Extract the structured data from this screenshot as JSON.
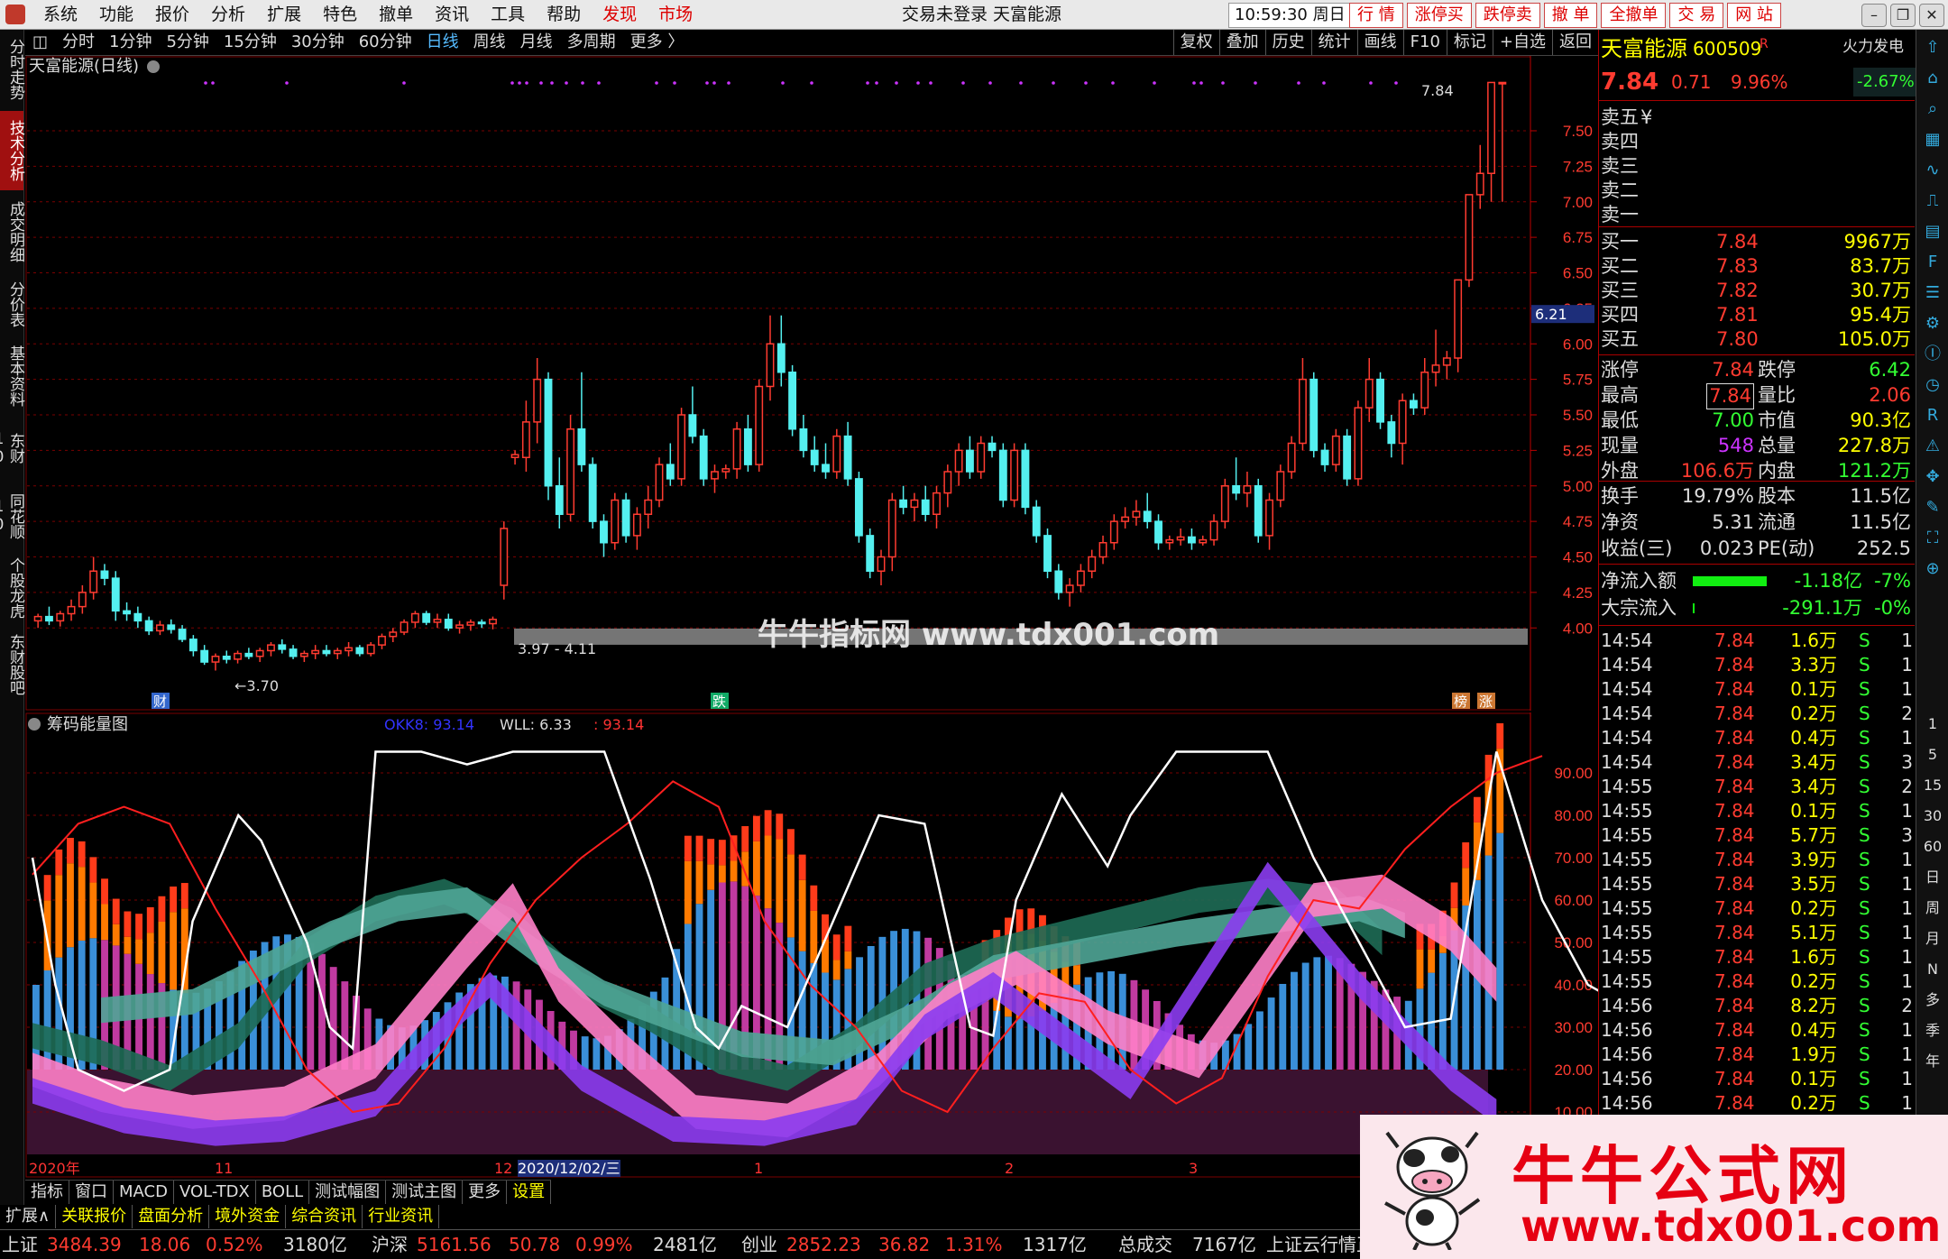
{
  "menu": {
    "items": [
      "系统",
      "功能",
      "报价",
      "分析",
      "扩展",
      "特色",
      "撤单",
      "资讯",
      "工具",
      "帮助"
    ],
    "discover": "发现",
    "market": "市场",
    "title": "交易未登录  天富能源",
    "clock": "10:59:30 周日",
    "quick": [
      "行 情",
      "涨停买",
      "跌停卖",
      "撤 单",
      "全撤单",
      "交 易",
      "网 站"
    ]
  },
  "left_tabs": [
    "分时走势",
    "技术分析",
    "成交明细",
    "分价表",
    "基本资料",
    "东财10",
    "同花顺10",
    "个股龙虎",
    "东财股吧"
  ],
  "periods": [
    "分时",
    "1分钟",
    "5分钟",
    "15分钟",
    "30分钟",
    "60分钟",
    "日线",
    "周线",
    "月线",
    "多周期",
    "更多 〉"
  ],
  "active_period": "日线",
  "right_tools": [
    "复权",
    "叠加",
    "历史",
    "统计",
    "画线",
    "F10",
    "标记",
    "+自选",
    "返回"
  ],
  "main_chart": {
    "title": "天富能源(日线)",
    "high_label": "7.84",
    "low_label": "3.70",
    "range_label": "3.97 - 4.11",
    "current_price_tag": "6.21",
    "y_ticks": [
      "7.50",
      "7.25",
      "7.00",
      "6.75",
      "6.50",
      "6.25",
      "6.00",
      "5.75",
      "5.50",
      "5.25",
      "5.00",
      "4.75",
      "4.50",
      "4.25",
      "4.00"
    ],
    "markers": [
      "财",
      "跌",
      "榜",
      "涨"
    ]
  },
  "indicator": {
    "title": "筹码能量图",
    "okk": "OKK8: 93.14",
    "wll": "WLL: 6.33",
    "last": ": 93.14",
    "y_ticks": [
      "90.00",
      "80.00",
      "70.00",
      "60.00",
      "50.00",
      "40.00",
      "30.00",
      "20.00",
      "10.00"
    ],
    "dates": [
      "2020年",
      "11",
      "12",
      "2020/12/02/三",
      "1",
      "2",
      "3"
    ]
  },
  "chart_data": {
    "type": "candlestick",
    "title": "天富能源(日线)",
    "ylim": [
      3.9,
      7.9
    ],
    "candles": [
      [
        4.05,
        4.1,
        4.0,
        4.08
      ],
      [
        4.08,
        4.15,
        4.02,
        4.05
      ],
      [
        4.05,
        4.12,
        4.01,
        4.1
      ],
      [
        4.1,
        4.2,
        4.05,
        4.15
      ],
      [
        4.15,
        4.3,
        4.1,
        4.25
      ],
      [
        4.25,
        4.5,
        4.2,
        4.4
      ],
      [
        4.4,
        4.45,
        4.3,
        4.35
      ],
      [
        4.35,
        4.4,
        4.05,
        4.12
      ],
      [
        4.12,
        4.18,
        4.05,
        4.1
      ],
      [
        4.1,
        4.15,
        4.0,
        4.05
      ],
      [
        4.05,
        4.08,
        3.95,
        3.98
      ],
      [
        3.98,
        4.05,
        3.95,
        4.02
      ],
      [
        4.02,
        4.06,
        3.96,
        3.99
      ],
      [
        3.99,
        4.02,
        3.9,
        3.92
      ],
      [
        3.92,
        3.95,
        3.8,
        3.84
      ],
      [
        3.84,
        3.88,
        3.74,
        3.76
      ],
      [
        3.76,
        3.82,
        3.7,
        3.8
      ],
      [
        3.8,
        3.84,
        3.75,
        3.78
      ],
      [
        3.78,
        3.84,
        3.75,
        3.82
      ],
      [
        3.82,
        3.86,
        3.78,
        3.8
      ],
      [
        3.8,
        3.86,
        3.76,
        3.84
      ],
      [
        3.84,
        3.9,
        3.8,
        3.88
      ],
      [
        3.88,
        3.92,
        3.82,
        3.85
      ],
      [
        3.85,
        3.88,
        3.78,
        3.8
      ],
      [
        3.8,
        3.84,
        3.76,
        3.82
      ],
      [
        3.82,
        3.88,
        3.78,
        3.84
      ],
      [
        3.84,
        3.88,
        3.8,
        3.82
      ],
      [
        3.82,
        3.86,
        3.78,
        3.84
      ],
      [
        3.84,
        3.9,
        3.8,
        3.86
      ],
      [
        3.86,
        3.88,
        3.8,
        3.82
      ],
      [
        3.82,
        3.9,
        3.8,
        3.88
      ],
      [
        3.88,
        3.96,
        3.85,
        3.94
      ],
      [
        3.94,
        4.0,
        3.9,
        3.97
      ],
      [
        3.97,
        4.06,
        3.95,
        4.04
      ],
      [
        4.04,
        4.12,
        4.0,
        4.1
      ],
      [
        4.1,
        4.12,
        4.02,
        4.04
      ],
      [
        4.04,
        4.1,
        4.0,
        4.06
      ],
      [
        4.06,
        4.1,
        3.98,
        4.0
      ],
      [
        4.0,
        4.05,
        3.96,
        4.02
      ],
      [
        4.02,
        4.06,
        3.98,
        4.04
      ],
      [
        4.04,
        4.06,
        4.0,
        4.03
      ],
      [
        4.03,
        4.08,
        3.99,
        4.06
      ],
      [
        4.3,
        4.75,
        4.2,
        4.7
      ],
      [
        5.2,
        5.25,
        5.15,
        5.22
      ],
      [
        5.2,
        5.6,
        5.1,
        5.45
      ],
      [
        5.45,
        5.9,
        5.3,
        5.75
      ],
      [
        5.75,
        5.8,
        4.9,
        5.0
      ],
      [
        5.0,
        5.2,
        4.7,
        4.8
      ],
      [
        4.8,
        5.5,
        4.75,
        5.4
      ],
      [
        5.4,
        5.8,
        5.1,
        5.15
      ],
      [
        5.15,
        5.2,
        4.7,
        4.75
      ],
      [
        4.75,
        4.8,
        4.5,
        4.6
      ],
      [
        4.6,
        4.95,
        4.55,
        4.9
      ],
      [
        4.9,
        4.95,
        4.6,
        4.65
      ],
      [
        4.65,
        4.85,
        4.55,
        4.8
      ],
      [
        4.8,
        5.0,
        4.7,
        4.9
      ],
      [
        4.9,
        5.2,
        4.85,
        5.15
      ],
      [
        5.15,
        5.3,
        5.0,
        5.05
      ],
      [
        5.05,
        5.55,
        5.0,
        5.5
      ],
      [
        5.5,
        5.7,
        5.3,
        5.35
      ],
      [
        5.35,
        5.4,
        5.0,
        5.05
      ],
      [
        5.05,
        5.15,
        4.95,
        5.1
      ],
      [
        5.1,
        5.15,
        5.05,
        5.12
      ],
      [
        5.12,
        5.45,
        5.05,
        5.4
      ],
      [
        5.4,
        5.5,
        5.1,
        5.15
      ],
      [
        5.15,
        5.75,
        5.1,
        5.7
      ],
      [
        5.7,
        6.2,
        5.6,
        6.0
      ],
      [
        6.0,
        6.2,
        5.7,
        5.8
      ],
      [
        5.8,
        5.85,
        5.35,
        5.4
      ],
      [
        5.4,
        5.5,
        5.2,
        5.25
      ],
      [
        5.25,
        5.35,
        5.1,
        5.15
      ],
      [
        5.15,
        5.3,
        5.05,
        5.1
      ],
      [
        5.1,
        5.4,
        5.05,
        5.35
      ],
      [
        5.35,
        5.45,
        5.0,
        5.05
      ],
      [
        5.05,
        5.1,
        4.6,
        4.65
      ],
      [
        4.65,
        4.7,
        4.35,
        4.4
      ],
      [
        4.4,
        4.55,
        4.3,
        4.5
      ],
      [
        4.5,
        4.95,
        4.4,
        4.9
      ],
      [
        4.9,
        5.0,
        4.8,
        4.85
      ],
      [
        4.85,
        4.95,
        4.75,
        4.9
      ],
      [
        4.9,
        5.0,
        4.75,
        4.8
      ],
      [
        4.8,
        5.0,
        4.7,
        4.95
      ],
      [
        4.95,
        5.15,
        4.85,
        5.1
      ],
      [
        5.1,
        5.3,
        5.0,
        5.25
      ],
      [
        5.25,
        5.35,
        5.05,
        5.1
      ],
      [
        5.1,
        5.35,
        5.05,
        5.3
      ],
      [
        5.3,
        5.35,
        5.2,
        5.25
      ],
      [
        5.25,
        5.3,
        4.85,
        4.9
      ],
      [
        4.9,
        5.3,
        4.85,
        5.25
      ],
      [
        5.25,
        5.3,
        4.8,
        4.85
      ],
      [
        4.85,
        4.9,
        4.6,
        4.65
      ],
      [
        4.65,
        4.7,
        4.35,
        4.4
      ],
      [
        4.4,
        4.45,
        4.2,
        4.25
      ],
      [
        4.25,
        4.35,
        4.15,
        4.3
      ],
      [
        4.3,
        4.45,
        4.25,
        4.4
      ],
      [
        4.4,
        4.55,
        4.35,
        4.5
      ],
      [
        4.5,
        4.65,
        4.45,
        4.6
      ],
      [
        4.6,
        4.8,
        4.55,
        4.75
      ],
      [
        4.75,
        4.85,
        4.7,
        4.78
      ],
      [
        4.78,
        4.9,
        4.72,
        4.82
      ],
      [
        4.82,
        4.95,
        4.7,
        4.75
      ],
      [
        4.75,
        4.8,
        4.55,
        4.6
      ],
      [
        4.6,
        4.65,
        4.55,
        4.62
      ],
      [
        4.62,
        4.7,
        4.58,
        4.64
      ],
      [
        4.64,
        4.7,
        4.55,
        4.6
      ],
      [
        4.6,
        4.65,
        4.58,
        4.62
      ],
      [
        4.62,
        4.8,
        4.58,
        4.75
      ],
      [
        4.75,
        5.05,
        4.7,
        5.0
      ],
      [
        5.0,
        5.2,
        4.9,
        4.95
      ],
      [
        4.95,
        5.1,
        4.85,
        5.0
      ],
      [
        5.0,
        5.05,
        4.6,
        4.65
      ],
      [
        4.65,
        4.95,
        4.55,
        4.9
      ],
      [
        4.9,
        5.15,
        4.85,
        5.1
      ],
      [
        5.1,
        5.35,
        5.05,
        5.3
      ],
      [
        5.3,
        5.9,
        5.25,
        5.75
      ],
      [
        5.75,
        5.8,
        5.2,
        5.25
      ],
      [
        5.25,
        5.3,
        5.1,
        5.15
      ],
      [
        5.15,
        5.4,
        5.1,
        5.35
      ],
      [
        5.35,
        5.4,
        5.0,
        5.05
      ],
      [
        5.05,
        5.6,
        5.0,
        5.55
      ],
      [
        5.55,
        5.9,
        5.45,
        5.75
      ],
      [
        5.75,
        5.8,
        5.4,
        5.45
      ],
      [
        5.45,
        5.5,
        5.2,
        5.3
      ],
      [
        5.3,
        5.65,
        5.15,
        5.6
      ],
      [
        5.6,
        5.65,
        5.5,
        5.55
      ],
      [
        5.55,
        5.9,
        5.5,
        5.8
      ],
      [
        5.8,
        6.1,
        5.7,
        5.85
      ],
      [
        5.85,
        5.95,
        5.75,
        5.9
      ],
      [
        5.9,
        6.45,
        5.8,
        6.45
      ],
      [
        6.45,
        7.05,
        6.4,
        7.05
      ],
      [
        7.05,
        7.4,
        6.95,
        7.2
      ],
      [
        7.2,
        7.84,
        7.0,
        7.84
      ],
      [
        7.84,
        7.84,
        7.0,
        7.84
      ]
    ]
  },
  "right_panel": {
    "name": "天富能源",
    "code": "600509",
    "code_mark": "R",
    "badge": "火力发电",
    "badge_pct": "-2.67%",
    "price": "7.84",
    "change": "0.71",
    "change_pct": "9.96%",
    "asks": [
      {
        "label": "卖五",
        "mark": "¥"
      },
      {
        "label": "卖四",
        "mark": ""
      },
      {
        "label": "卖三",
        "mark": ""
      },
      {
        "label": "卖二",
        "mark": ""
      },
      {
        "label": "卖一",
        "mark": ""
      }
    ],
    "bids": [
      {
        "label": "买一",
        "price": "7.84",
        "vol": "9967万"
      },
      {
        "label": "买二",
        "price": "7.83",
        "vol": "83.7万"
      },
      {
        "label": "买三",
        "price": "7.82",
        "vol": "30.7万"
      },
      {
        "label": "买四",
        "price": "7.81",
        "vol": "95.4万"
      },
      {
        "label": "买五",
        "price": "7.80",
        "vol": "105.0万"
      }
    ],
    "stats": [
      {
        "l1": "涨停",
        "v1": "7.84",
        "l2": "跌停",
        "v2": "6.42"
      },
      {
        "l1": "最高",
        "v1": "7.84",
        "l2": "量比",
        "v2": "2.06"
      },
      {
        "l1": "最低",
        "v1": "7.00",
        "l2": "市值",
        "v2": "90.3亿"
      },
      {
        "l1": "现量",
        "v1": "548",
        "l2": "总量",
        "v2": "227.8万"
      },
      {
        "l1": "外盘",
        "v1": "106.6万",
        "l2": "内盘",
        "v2": "121.2万"
      }
    ],
    "stats2": [
      {
        "l1": "换手",
        "v1": "19.79%",
        "l2": "股本",
        "v2": "11.5亿"
      },
      {
        "l1": "净资",
        "v1": "5.31",
        "l2": "流通",
        "v2": "11.5亿"
      },
      {
        "l1": "收益(三)",
        "v1": "0.023",
        "l2": "PE(动)",
        "v2": "252.5"
      }
    ],
    "flows": [
      {
        "label": "净流入额",
        "value": "-1.18亿",
        "pct": "-7%"
      },
      {
        "label": "大宗流入",
        "value": "-291.1万",
        "pct": "-0%"
      }
    ],
    "ticks": [
      {
        "t": "14:54",
        "p": "7.84",
        "v": "1.6万",
        "s": "S",
        "n": "1"
      },
      {
        "t": "14:54",
        "p": "7.84",
        "v": "3.3万",
        "s": "S",
        "n": "1"
      },
      {
        "t": "14:54",
        "p": "7.84",
        "v": "0.1万",
        "s": "S",
        "n": "1"
      },
      {
        "t": "14:54",
        "p": "7.84",
        "v": "0.2万",
        "s": "S",
        "n": "2"
      },
      {
        "t": "14:54",
        "p": "7.84",
        "v": "0.4万",
        "s": "S",
        "n": "1"
      },
      {
        "t": "14:54",
        "p": "7.84",
        "v": "3.4万",
        "s": "S",
        "n": "3"
      },
      {
        "t": "14:55",
        "p": "7.84",
        "v": "3.4万",
        "s": "S",
        "n": "2"
      },
      {
        "t": "14:55",
        "p": "7.84",
        "v": "0.1万",
        "s": "S",
        "n": "1"
      },
      {
        "t": "14:55",
        "p": "7.84",
        "v": "5.7万",
        "s": "S",
        "n": "3"
      },
      {
        "t": "14:55",
        "p": "7.84",
        "v": "3.9万",
        "s": "S",
        "n": "1"
      },
      {
        "t": "14:55",
        "p": "7.84",
        "v": "3.5万",
        "s": "S",
        "n": "1"
      },
      {
        "t": "14:55",
        "p": "7.84",
        "v": "0.2万",
        "s": "S",
        "n": "1"
      },
      {
        "t": "14:55",
        "p": "7.84",
        "v": "5.1万",
        "s": "S",
        "n": "1"
      },
      {
        "t": "14:55",
        "p": "7.84",
        "v": "1.6万",
        "s": "S",
        "n": "1"
      },
      {
        "t": "14:55",
        "p": "7.84",
        "v": "0.2万",
        "s": "S",
        "n": "1"
      },
      {
        "t": "14:56",
        "p": "7.84",
        "v": "8.2万",
        "s": "S",
        "n": "2"
      },
      {
        "t": "14:56",
        "p": "7.84",
        "v": "0.4万",
        "s": "S",
        "n": "1"
      },
      {
        "t": "14:56",
        "p": "7.84",
        "v": "1.9万",
        "s": "S",
        "n": "1"
      },
      {
        "t": "14:56",
        "p": "7.84",
        "v": "0.1万",
        "s": "S",
        "n": "1"
      },
      {
        "t": "14:56",
        "p": "7.84",
        "v": "0.2万",
        "s": "S",
        "n": "1"
      }
    ]
  },
  "right_toolbar_text": [
    "1",
    "5",
    "15",
    "30",
    "60",
    "日",
    "周",
    "月",
    "N",
    "多",
    "季",
    "年"
  ],
  "indicator_tabs": [
    "指标",
    "窗口",
    "MACD",
    "VOL-TDX",
    "BOLL",
    "测试幅图",
    "测试主图",
    "更多",
    "设置"
  ],
  "ext_tabs": [
    "扩展∧",
    "关联报价",
    "盘面分析",
    "境外资金",
    "综合资讯",
    "行业资讯"
  ],
  "status": [
    {
      "name": "上证",
      "val": "3484.39",
      "chg": "18.06",
      "pct": "0.52%",
      "amt": "3180亿"
    },
    {
      "name": "沪深",
      "val": "5161.56",
      "chg": "50.78",
      "pct": "0.99%",
      "amt": "2481亿"
    },
    {
      "name": "创业",
      "val": "2852.23",
      "chg": "36.82",
      "pct": "1.31%",
      "amt": "1317亿"
    }
  ],
  "status_total_label": "总成交",
  "status_total": "7167亿",
  "status_tail": "上证云行情正",
  "watermark_mid": "牛牛指标网 www.tdx001.com",
  "watermark_title": "牛牛公式网",
  "watermark_url": "www.tdx001.com",
  "colors": {
    "up": "#ff3b30",
    "down": "#54f0f0",
    "accent": "#e60012",
    "grid": "#7a0000"
  }
}
